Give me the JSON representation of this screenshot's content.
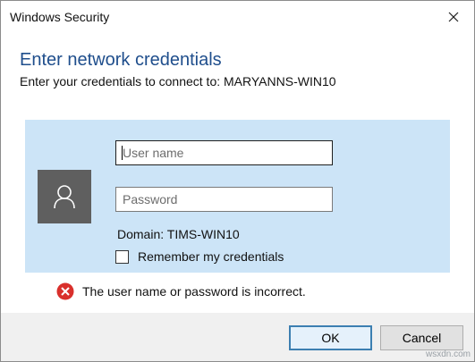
{
  "window": {
    "title": "Windows Security",
    "close_icon": "close-icon"
  },
  "dialog": {
    "heading": "Enter network credentials",
    "subheading": "Enter your credentials to connect to: MARYANNS-WIN10"
  },
  "credentials": {
    "avatar_icon": "user-icon",
    "username_placeholder": "User name",
    "username_value": "",
    "password_placeholder": "Password",
    "password_value": "",
    "domain_text": "Domain: TIMS-WIN10",
    "remember_label": "Remember my credentials",
    "remember_checked": false
  },
  "error": {
    "icon": "error-icon",
    "message": "The user name or password is incorrect."
  },
  "buttons": {
    "ok_label": "OK",
    "cancel_label": "Cancel"
  },
  "watermark": "wsxdn.com",
  "colors": {
    "heading": "#1f4e8c",
    "panel_background": "#cce4f7",
    "avatar_background": "#5f5f5f",
    "error_red": "#d9302c",
    "footer_background": "#f0f0f0",
    "default_button_border": "#3c7fb1"
  }
}
